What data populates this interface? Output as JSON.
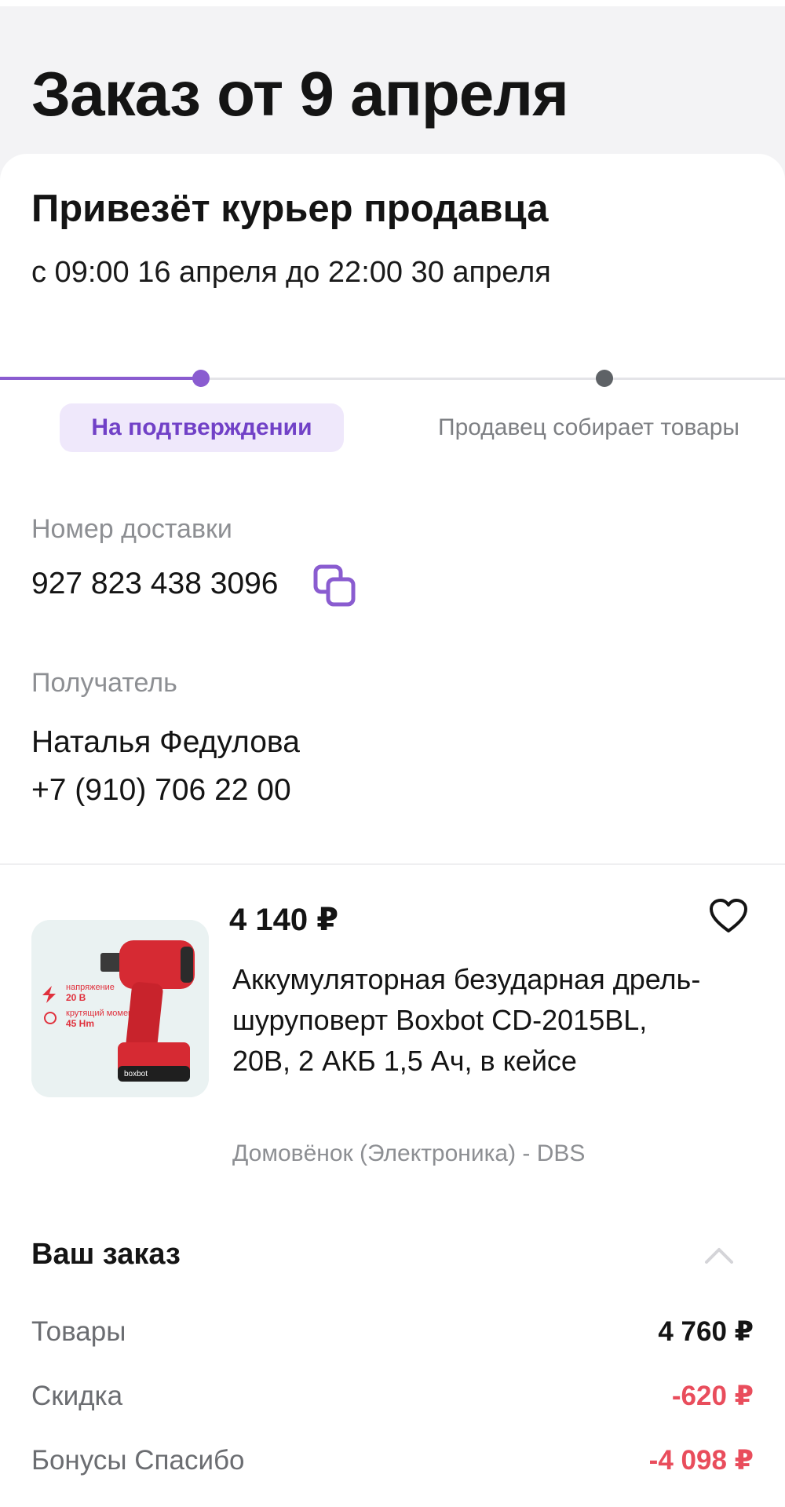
{
  "page": {
    "title": "Заказ от 9 апреля"
  },
  "delivery": {
    "title": "Привезёт курьер продавца",
    "window": "с 09:00 16 апреля до 22:00 30 апреля"
  },
  "progress": {
    "current_step": "На подтверждении",
    "next_step": "Продавец собирает товары",
    "colors": {
      "active": "#8a5cd0",
      "inactive": "#5e6266"
    }
  },
  "tracking": {
    "label": "Номер доставки",
    "number": "927 823 438 3096",
    "icon": "copy-icon"
  },
  "recipient": {
    "label": "Получатель",
    "name": "Наталья Федулова",
    "phone": "+7 (910) 706 22 00"
  },
  "product": {
    "price": "4 140 ₽",
    "name": "Аккумуляторная безударная дрель-шуруповерт Boxbot CD-2015BL, 20В, 2 АКБ 1,5 Ач, в кейсе",
    "seller": "Домовёнок (Электроника) - DBS",
    "image": {
      "brand": "boxbot",
      "spec1_label": "напряжение",
      "spec1_value": "20 В",
      "spec2_label": "крутящий момент",
      "spec2_value": "45 Нm"
    },
    "favorite_icon": "heart-icon"
  },
  "summary": {
    "title": "Ваш заказ",
    "toggle_icon": "chevron-up-icon",
    "rows": [
      {
        "label": "Товары",
        "value": "4 760 ₽"
      },
      {
        "label": "Скидка",
        "value": "-620 ₽"
      },
      {
        "label": "Бонусы Спасибо",
        "value": "-4 098 ₽"
      }
    ]
  }
}
